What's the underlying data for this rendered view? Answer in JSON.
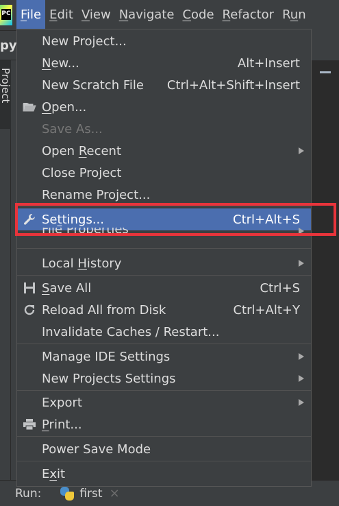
{
  "menubar": {
    "items": [
      {
        "pre": "",
        "mn": "F",
        "post": "ile"
      },
      {
        "pre": "",
        "mn": "E",
        "post": "dit"
      },
      {
        "pre": "",
        "mn": "V",
        "post": "iew"
      },
      {
        "pre": "",
        "mn": "N",
        "post": "avigate"
      },
      {
        "pre": "",
        "mn": "C",
        "post": "ode"
      },
      {
        "pre": "",
        "mn": "R",
        "post": "efactor"
      },
      {
        "pre": "R",
        "mn": "u",
        "post": "n"
      }
    ]
  },
  "background": {
    "project_name": "pyt",
    "project_tab": "Project",
    "run_label": "Run:",
    "run_config": "first",
    "close_glyph": "×"
  },
  "file_menu": {
    "new_project": "New Project...",
    "new_pre": "",
    "new_mn": "N",
    "new_post": "ew...",
    "new_shortcut": "Alt+Insert",
    "new_scratch": "New Scratch File",
    "new_scratch_shortcut": "Ctrl+Alt+Shift+Insert",
    "open_pre": "",
    "open_mn": "O",
    "open_post": "pen...",
    "save_as": "Save As...",
    "open_recent_pre": "Open ",
    "open_recent_mn": "R",
    "open_recent_post": "ecent",
    "close_project": "Close Project",
    "rename_project": "Rename Project...",
    "settings_pre": "Se",
    "settings_mn": "t",
    "settings_post": "tings...",
    "settings_shortcut": "Ctrl+Alt+S",
    "file_properties": "File Properties",
    "local_history_pre": "Local ",
    "local_history_mn": "H",
    "local_history_post": "istory",
    "save_all_pre": "",
    "save_all_mn": "S",
    "save_all_post": "ave All",
    "save_all_shortcut": "Ctrl+S",
    "reload": "Reload All from Disk",
    "reload_shortcut": "Ctrl+Alt+Y",
    "invalidate": "Invalidate Caches / Restart...",
    "manage_ide": "Manage IDE Settings",
    "new_projects_settings": "New Projects Settings",
    "export": "Export",
    "print_pre": "",
    "print_mn": "P",
    "print_post": "rint...",
    "power_save": "Power Save Mode",
    "exit_pre": "E",
    "exit_mn": "x",
    "exit_post": "it"
  },
  "colors": {
    "selection": "#4b6eaf",
    "highlight_box": "#e8343b",
    "menu_bg": "#3c3f41"
  }
}
